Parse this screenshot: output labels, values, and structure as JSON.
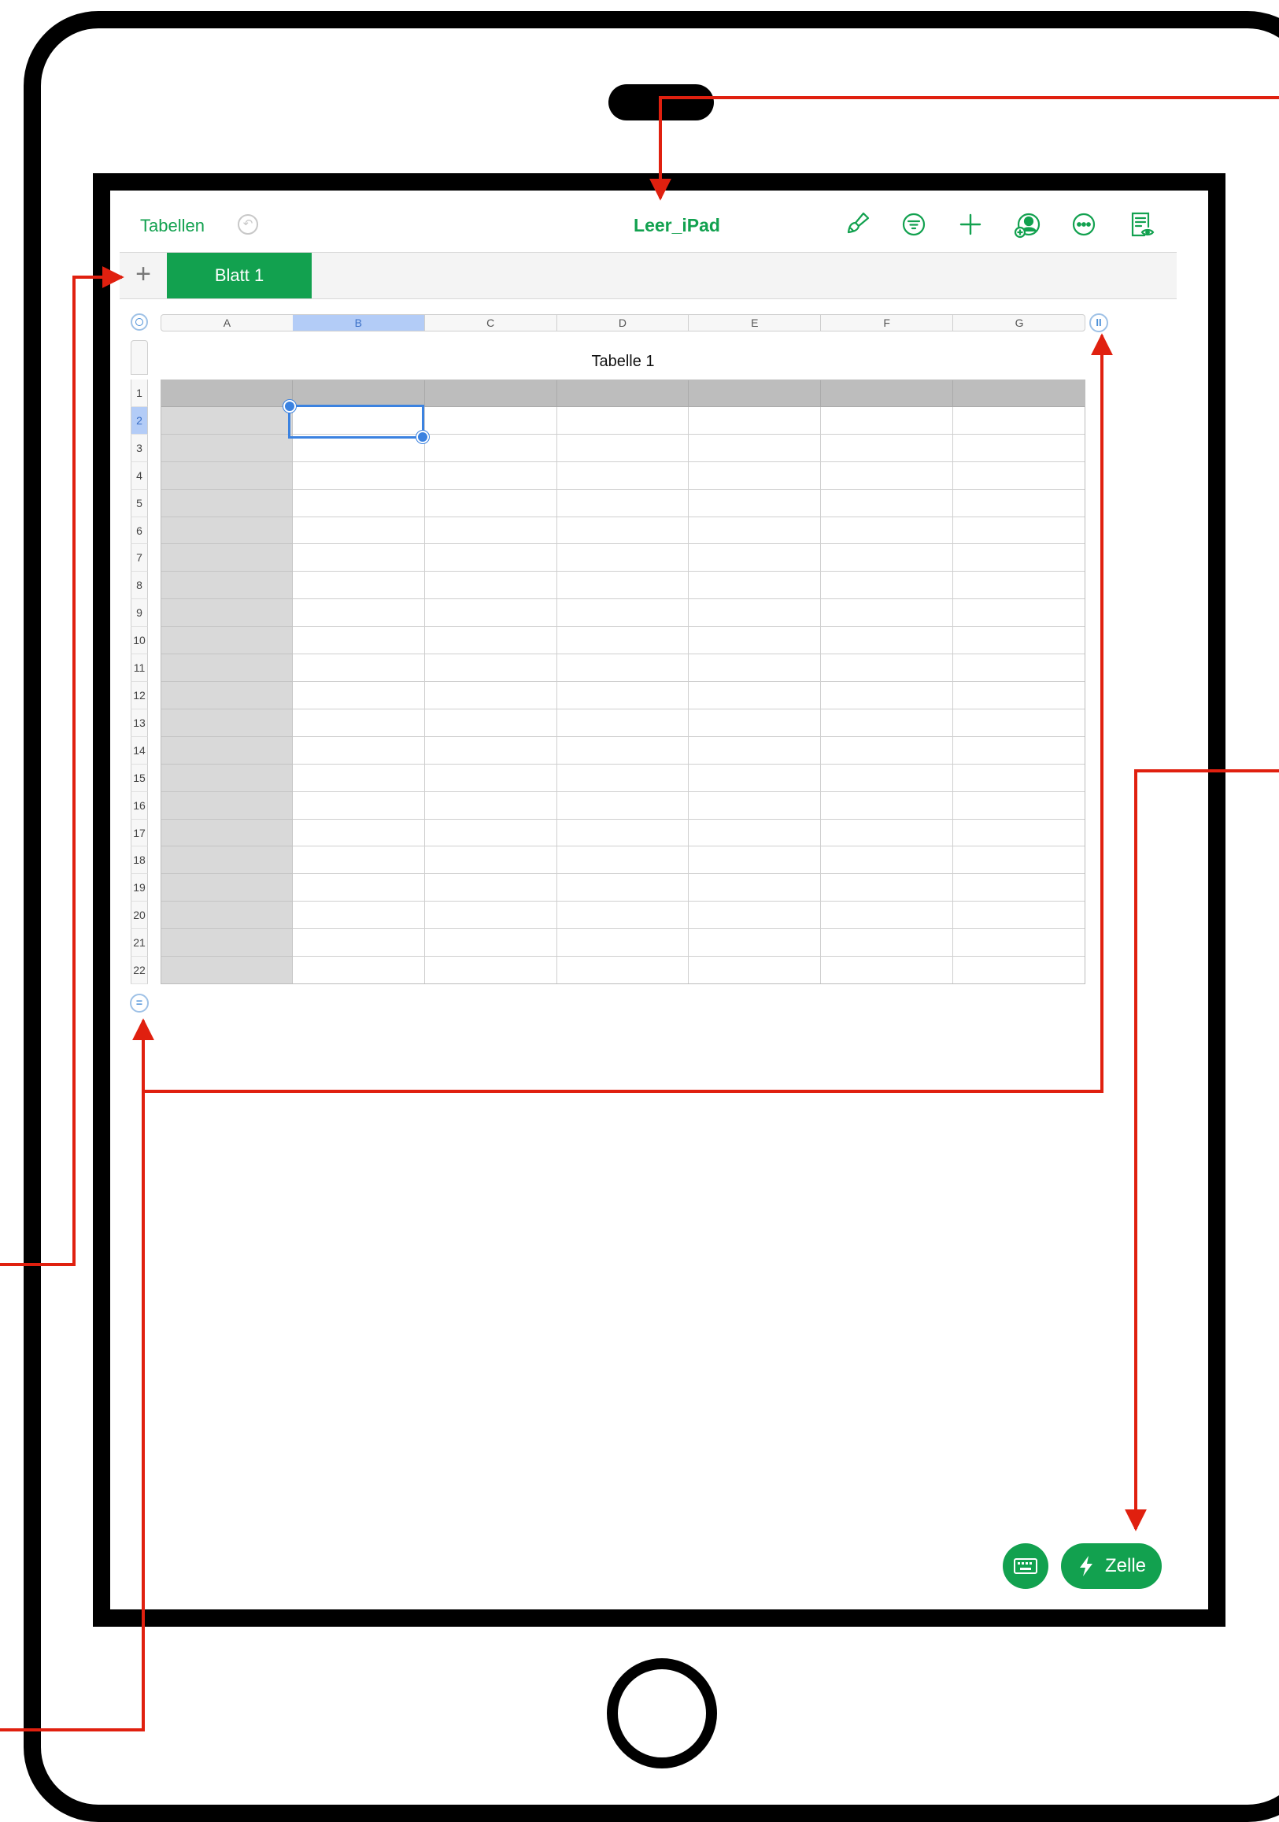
{
  "toolbar": {
    "back_label": "Tabellen",
    "document_title": "Leer_iPad",
    "icons": [
      "paintbrush-icon",
      "filter-icon",
      "plus-icon",
      "collaborate-icon",
      "more-icon",
      "reader-view-icon"
    ]
  },
  "sheets": {
    "add_label": "+",
    "tabs": [
      {
        "label": "Blatt 1",
        "active": true
      }
    ]
  },
  "table": {
    "title": "Tabelle 1",
    "columns": [
      "A",
      "B",
      "C",
      "D",
      "E",
      "F",
      "G"
    ],
    "rows": [
      "1",
      "2",
      "3",
      "4",
      "5",
      "6",
      "7",
      "8",
      "9",
      "10",
      "11",
      "12",
      "13",
      "14",
      "15",
      "16",
      "17",
      "18",
      "19",
      "20",
      "21",
      "22"
    ],
    "selected_column": "B",
    "selected_row": "2",
    "header_rows": 1,
    "header_columns": 1
  },
  "bottom": {
    "keyboard_icon": "keyboard-icon",
    "cell_button_label": "Zelle",
    "cell_button_icon": "lightning-icon"
  },
  "colors": {
    "accent": "#12a14f",
    "selection": "#3b82e0",
    "callout": "#e0200f"
  }
}
